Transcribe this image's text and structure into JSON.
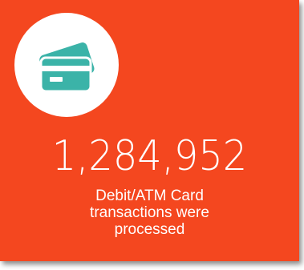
{
  "tile": {
    "background_color": "#f4471f",
    "icon": "credit-card-icon",
    "icon_color": "#3bb3a8",
    "value": "1,284,952",
    "caption_lines": [
      "Debit/ATM Card",
      "transactions were",
      "processed"
    ]
  }
}
